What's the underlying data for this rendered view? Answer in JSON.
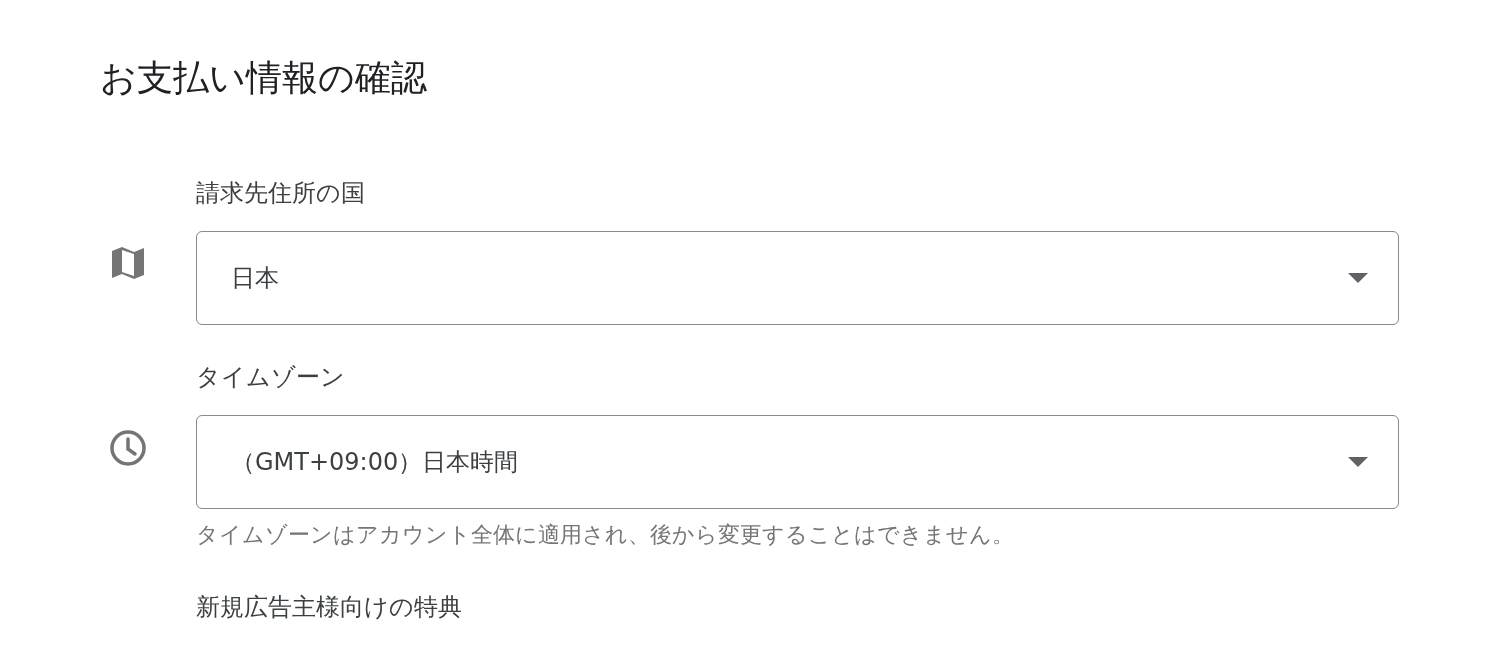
{
  "page_title": "お支払い情報の確認",
  "fields": [
    {
      "label": "請求先住所の国",
      "kind": "map",
      "value": "日本"
    },
    {
      "label": "タイムゾーン",
      "kind": "clock",
      "value": "（GMT+09:00）日本時間",
      "helper": "タイムゾーンはアカウント全体に適用され、後から変更することはできません。"
    }
  ],
  "section_label": "新規広告主様向けの特典"
}
